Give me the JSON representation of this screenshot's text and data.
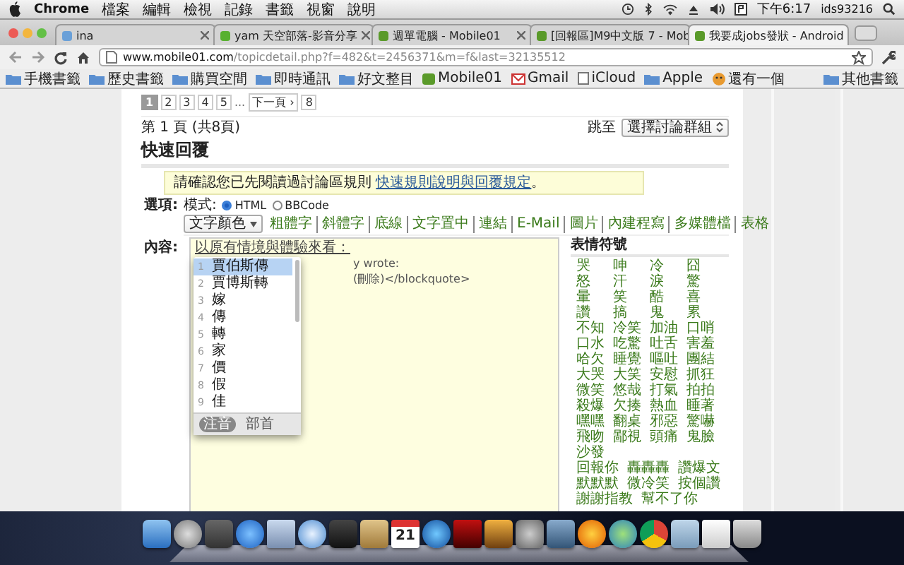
{
  "menu_bar": {
    "app": "Chrome",
    "menus": [
      "檔案",
      "編輯",
      "檢視",
      "記錄",
      "書籤",
      "視窗",
      "說明"
    ],
    "clock": "下午6:17",
    "user": "ids93216"
  },
  "tabs": [
    {
      "title": "ina",
      "selected": false
    },
    {
      "title": "yam 天空部落-影音分享",
      "selected": false
    },
    {
      "title": "週單電腦 - Mobile01",
      "selected": false
    },
    {
      "title": "[回報區]M9中文版 7 - Mob",
      "selected": false
    },
    {
      "title": "我要成jobs發狀 - Android",
      "selected": true
    }
  ],
  "address_bar": {
    "host": "www.mobile01.com",
    "path": "/topicdetail.php?f=482&t=2456371&m=f&last=32135512"
  },
  "bookmarks": {
    "items": [
      {
        "label": "手機書籤",
        "kind": "folder"
      },
      {
        "label": "歷史書籤",
        "kind": "folder"
      },
      {
        "label": "購買空間",
        "kind": "folder"
      },
      {
        "label": "即時通訊",
        "kind": "folder"
      },
      {
        "label": "好文整目",
        "kind": "folder"
      },
      {
        "label": "Mobile01",
        "kind": "site"
      },
      {
        "label": "Gmail",
        "kind": "mail"
      },
      {
        "label": "iCloud",
        "kind": "page"
      },
      {
        "label": "Apple",
        "kind": "folder"
      },
      {
        "label": "還有一個",
        "kind": "face"
      }
    ],
    "other": "其他書籤"
  },
  "pagination": [
    {
      "label": "1",
      "kind": "page",
      "selected": true
    },
    {
      "label": "2",
      "kind": "page",
      "selected": false
    },
    {
      "label": "3",
      "kind": "page",
      "selected": false
    },
    {
      "label": "4",
      "kind": "page",
      "selected": false
    },
    {
      "label": "5",
      "kind": "page",
      "selected": false
    },
    {
      "label": "...",
      "kind": "gap",
      "selected": false
    },
    {
      "label": "下一頁 ›",
      "kind": "page",
      "selected": false
    },
    {
      "label": "8",
      "kind": "page",
      "selected": false
    }
  ],
  "page_info": "第 1 頁 (共8頁)",
  "jump": {
    "label": "跳至",
    "select": "選擇討論群組"
  },
  "quick_reply": {
    "heading": "快速回覆",
    "notice": {
      "text": "請確認您已先閱讀過討論區規則 ",
      "link": "快速規則說明與回覆規定",
      "end": "。"
    },
    "format": {
      "label": "選項:",
      "mode_label": "模式:",
      "options": [
        {
          "label": "HTML",
          "selected": true
        },
        {
          "label": "BBCode",
          "selected": false
        }
      ]
    },
    "toolbar": {
      "color_select": "文字顏色",
      "links": [
        "粗體字",
        "斜體字",
        "底線",
        "文字置中",
        "連結",
        "E-Mail",
        "圖片",
        "內建程寫",
        "多媒體檔",
        "表格"
      ]
    },
    "content": {
      "label": "內容:",
      "composition": "以原有情境與體驗來看：",
      "lines": [
        "y wrote:",
        "(刪除)</blockquote>"
      ]
    },
    "ime": {
      "candidates": [
        {
          "n": "1",
          "text": "賈伯斯傳",
          "selected": true
        },
        {
          "n": "2",
          "text": "賈博斯轉",
          "selected": false
        },
        {
          "n": "3",
          "text": "嫁",
          "selected": false
        },
        {
          "n": "4",
          "text": "傳",
          "selected": false
        },
        {
          "n": "5",
          "text": "轉",
          "selected": false
        },
        {
          "n": "6",
          "text": "家",
          "selected": false
        },
        {
          "n": "7",
          "text": "價",
          "selected": false
        },
        {
          "n": "8",
          "text": "假",
          "selected": false
        },
        {
          "n": "9",
          "text": "佳",
          "selected": false
        }
      ],
      "modes": [
        {
          "label": "注音",
          "selected": true
        },
        {
          "label": "部首",
          "selected": false
        }
      ]
    }
  },
  "emoticons": {
    "heading": "表情符號",
    "rows": [
      [
        "哭",
        "呻",
        "冷",
        "囧"
      ],
      [
        "怒",
        "汗",
        "淚",
        "驚"
      ],
      [
        "暈",
        "笑",
        "酷",
        "喜"
      ],
      [
        "讚",
        "搞",
        "鬼",
        "累"
      ],
      [
        "不知",
        "冷笑",
        "加油",
        "口哨"
      ],
      [
        "口水",
        "吃驚",
        "吐舌",
        "害羞"
      ],
      [
        "哈欠",
        "睡覺",
        "嘔吐",
        "團結"
      ],
      [
        "大哭",
        "大笑",
        "安慰",
        "抓狂"
      ],
      [
        "微笑",
        "悠哉",
        "打氣",
        "拍拍"
      ],
      [
        "殺爆",
        "欠揍",
        "熱血",
        "睡著"
      ],
      [
        "嘿嘿",
        "翻桌",
        "邪惡",
        "驚嚇"
      ],
      [
        "飛吻",
        "鄙視",
        "頭痛",
        "鬼臉"
      ],
      [
        "沙發"
      ],
      [
        "回報你",
        "轟轟轟",
        "讚爆文"
      ],
      [
        "默默默",
        "微冷笑",
        "按個讚"
      ],
      [
        "謝謝指教",
        "幫不了你"
      ]
    ]
  },
  "dock": {
    "calendar_day": "21"
  }
}
